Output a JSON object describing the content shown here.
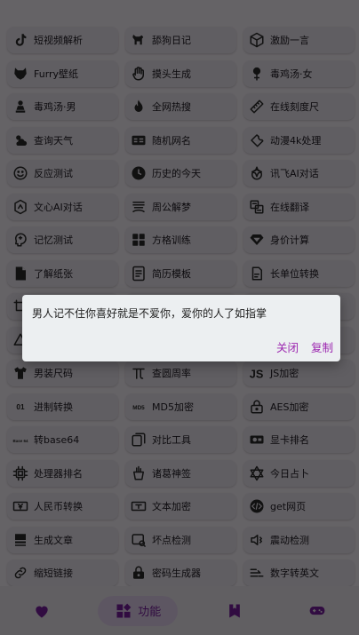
{
  "tools": [
    {
      "label": "短视频解析",
      "icon": "tiktok-icon"
    },
    {
      "label": "舔狗日记",
      "icon": "dog-icon"
    },
    {
      "label": "激励一言",
      "icon": "cube-icon"
    },
    {
      "label": "Furry壁纸",
      "icon": "fox-icon"
    },
    {
      "label": "摸头生成",
      "icon": "hand-icon"
    },
    {
      "label": "毒鸡汤·女",
      "icon": "female-icon"
    },
    {
      "label": "毒鸡汤·男",
      "icon": "male-icon"
    },
    {
      "label": "全网热搜",
      "icon": "fire-icon"
    },
    {
      "label": "在线刻度尺",
      "icon": "ruler-icon"
    },
    {
      "label": "查询天气",
      "icon": "weather-icon"
    },
    {
      "label": "随机网名",
      "icon": "name-card-icon"
    },
    {
      "label": "动漫4k处理",
      "icon": "wrench-icon"
    },
    {
      "label": "反应测试",
      "icon": "smiley-icon"
    },
    {
      "label": "历史的今天",
      "icon": "clock-icon"
    },
    {
      "label": "讯飞AI对话",
      "icon": "sparkle-icon"
    },
    {
      "label": "文心AI对话",
      "icon": "ai-hexagon-icon"
    },
    {
      "label": "周公解梦",
      "icon": "dream-icon"
    },
    {
      "label": "在线翻译",
      "icon": "translate-icon"
    },
    {
      "label": "记忆测试",
      "icon": "brain-icon"
    },
    {
      "label": "方格训练",
      "icon": "grid-numbers-icon"
    },
    {
      "label": "身价计算",
      "icon": "diamond-icon"
    },
    {
      "label": "了解纸张",
      "icon": "paper-icon"
    },
    {
      "label": "简历模板",
      "icon": "resume-icon"
    },
    {
      "label": "长单位转换",
      "icon": "length-icon"
    },
    {
      "label": "",
      "icon": "crop-icon"
    },
    {
      "label": "",
      "icon": "blank"
    },
    {
      "label": "",
      "icon": "blank"
    },
    {
      "label": "",
      "icon": "triangle-icon"
    },
    {
      "label": "",
      "icon": "blank"
    },
    {
      "label": "",
      "icon": "blank"
    },
    {
      "label": "男装尺码",
      "icon": "shirt-icon"
    },
    {
      "label": "查圆周率",
      "icon": "pi-icon"
    },
    {
      "label": "JS加密",
      "icon": "js-icon"
    },
    {
      "label": "进制转换",
      "icon": "binary-icon",
      "icon_text": "01"
    },
    {
      "label": "MD5加密",
      "icon": "md5-icon",
      "icon_text": "MD5"
    },
    {
      "label": "AES加密",
      "icon": "lock-icon"
    },
    {
      "label": "转base64",
      "icon": "base64-icon",
      "icon_text": "Base 64"
    },
    {
      "label": "对比工具",
      "icon": "compare-icon"
    },
    {
      "label": "显卡排名",
      "icon": "gpu-icon"
    },
    {
      "label": "处理器排名",
      "icon": "cpu-icon"
    },
    {
      "label": "诸葛神签",
      "icon": "fortune-icon"
    },
    {
      "label": "今日占卜",
      "icon": "star-of-david-icon"
    },
    {
      "label": "人民币转换",
      "icon": "currency-icon"
    },
    {
      "label": "文本加密",
      "icon": "text-lock-icon"
    },
    {
      "label": "get网页",
      "icon": "code-icon"
    },
    {
      "label": "生成文章",
      "icon": "article-icon"
    },
    {
      "label": "坏点检测",
      "icon": "pixel-check-icon"
    },
    {
      "label": "震动检测",
      "icon": "vibrate-icon"
    },
    {
      "label": "缩短链接",
      "icon": "link-icon"
    },
    {
      "label": "密码生成器",
      "icon": "password-icon"
    },
    {
      "label": "数字转英文",
      "icon": "number-convert-icon"
    }
  ],
  "nav": {
    "items": [
      {
        "icon": "heart-icon",
        "label": ""
      },
      {
        "icon": "widgets-icon",
        "label": "功能"
      },
      {
        "icon": "bookmark-icon",
        "label": ""
      },
      {
        "icon": "gamepad-icon",
        "label": ""
      }
    ],
    "active_index": 1
  },
  "dialog": {
    "message": "男人记不住你喜好就是不爱你，爱你的人了如指掌",
    "close_label": "关闭",
    "copy_label": "复制"
  },
  "colors": {
    "accent": "#9c27b0",
    "nav_icon": "#7b1fa2",
    "tile_bg": "#f1ecf4",
    "dialog_bg": "#eceff1"
  }
}
